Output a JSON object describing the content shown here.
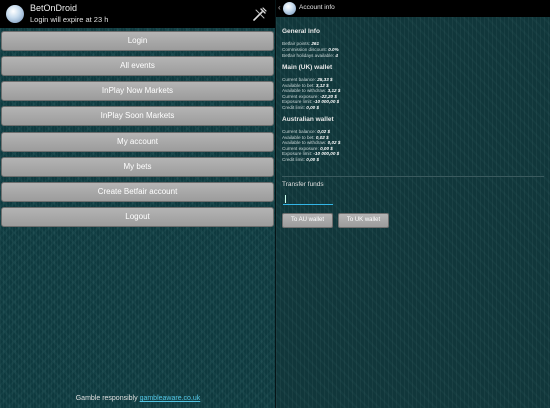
{
  "left": {
    "app_title": "BetOnDroid",
    "app_subtitle": "Login will expire at 23 h",
    "menu": [
      {
        "label": "Login"
      },
      {
        "label": "All events"
      },
      {
        "label": "InPlay Now Markets"
      },
      {
        "label": "InPlay Soon Markets"
      },
      {
        "label": "My account"
      },
      {
        "label": "My bets"
      },
      {
        "label": "Create Betfair account"
      },
      {
        "label": "Logout"
      }
    ],
    "footer": {
      "text": "Gamble responsibly",
      "link": "gambleaware.co.uk"
    }
  },
  "right": {
    "title": "Account info",
    "general": {
      "title": "General Info",
      "rows": [
        {
          "label": "Betfair points:",
          "value": "261"
        },
        {
          "label": "Commission discount:",
          "value": "0.0%"
        },
        {
          "label": "Betfair holidays available:",
          "value": "4"
        }
      ]
    },
    "uk_wallet": {
      "title": "Main (UK) wallet",
      "rows": [
        {
          "label": "Current balance:",
          "value": "25,33 $"
        },
        {
          "label": "Available to bet:",
          "value": "3,12 $"
        },
        {
          "label": "Available to withdraw:",
          "value": "3,12 $"
        },
        {
          "label": "Current exposure:",
          "value": "-22,20 $"
        },
        {
          "label": "Exposure limit:",
          "value": "-10 000,00 $"
        },
        {
          "label": "Credit limit:",
          "value": "0,00 $"
        }
      ]
    },
    "au_wallet": {
      "title": "Australian wallet",
      "rows": [
        {
          "label": "Current balance:",
          "value": "0,02 $"
        },
        {
          "label": "Available to bet:",
          "value": "0,02 $"
        },
        {
          "label": "Available to withdraw:",
          "value": "0,02 $"
        },
        {
          "label": "Current exposure:",
          "value": "0,00 $"
        },
        {
          "label": "Exposure limit:",
          "value": "-10 000,00 $"
        },
        {
          "label": "Credit limit:",
          "value": "0,00 $"
        }
      ]
    },
    "transfer": {
      "label": "Transfer funds",
      "input_value": "",
      "to_au_label": "To AU wallet",
      "to_uk_label": "To UK wallet"
    }
  },
  "colors": {
    "accent": "#33b5e5",
    "link": "#53c7e6",
    "button": "#a8a8a8",
    "background": "#0f3a3f"
  }
}
